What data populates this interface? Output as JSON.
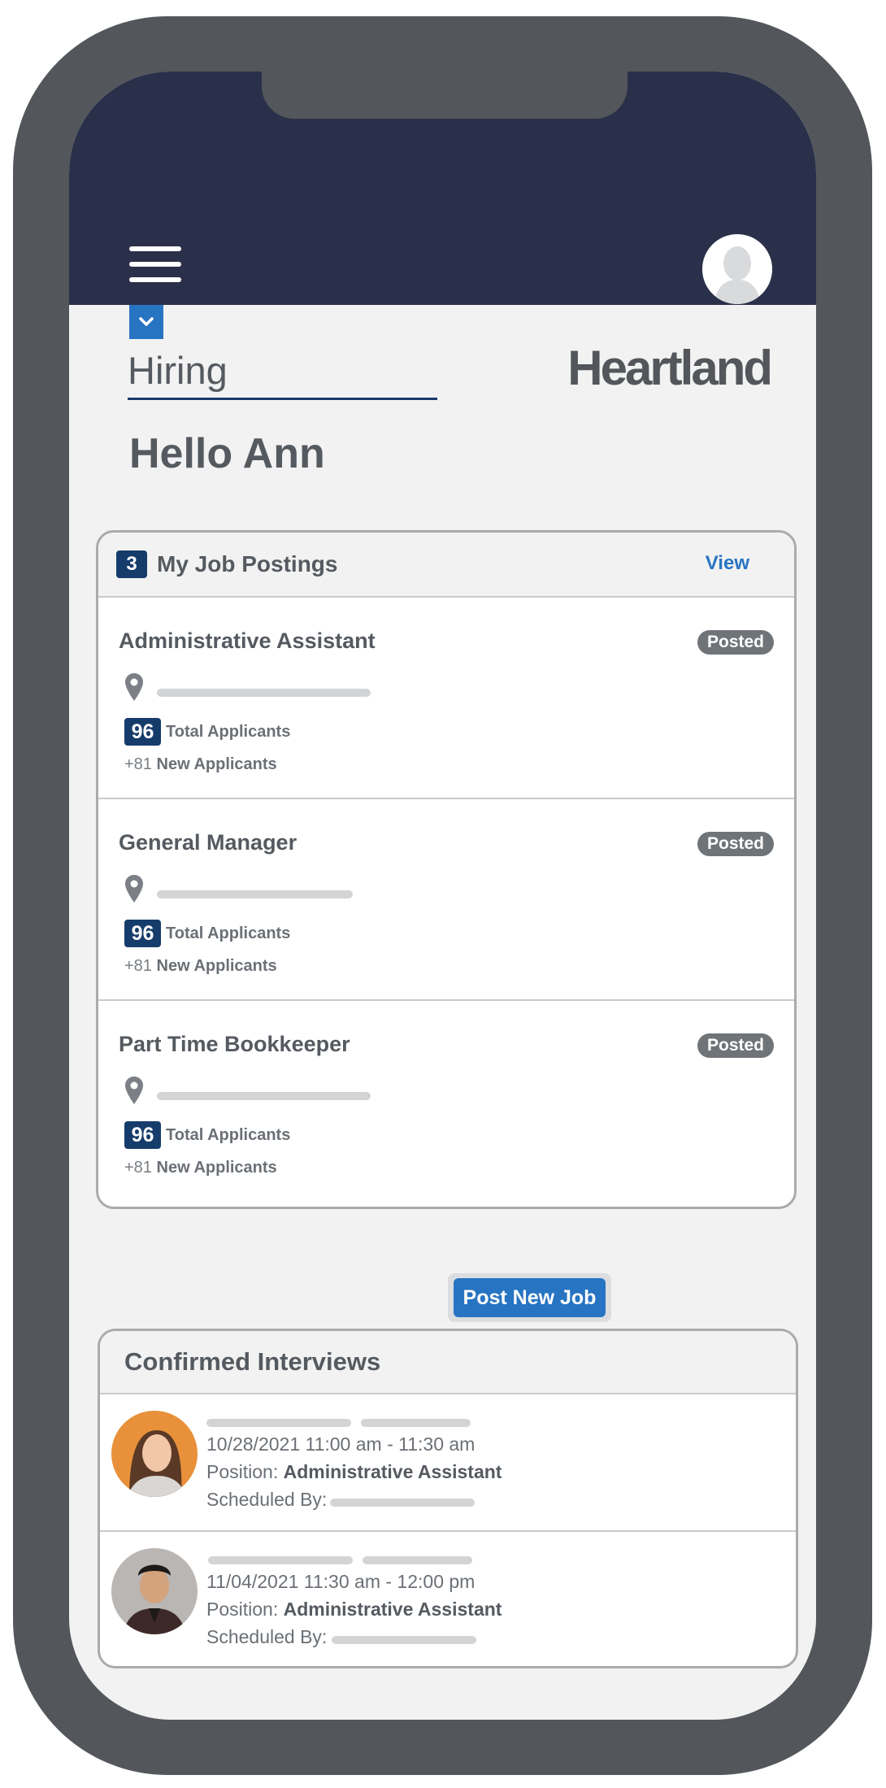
{
  "header": {
    "section_label": "Hiring",
    "brand": "Heartland",
    "greeting": "Hello Ann"
  },
  "job_postings": {
    "count": "3",
    "title": "My Job Postings",
    "view_label": "View",
    "jobs": [
      {
        "title": "Administrative Assistant",
        "status": "Posted",
        "total": "96",
        "total_label": "Total Applicants",
        "new_count": "+81",
        "new_label": "New Applicants"
      },
      {
        "title": "General Manager",
        "status": "Posted",
        "total": "96",
        "total_label": "Total Applicants",
        "new_count": "+81",
        "new_label": "New Applicants"
      },
      {
        "title": "Part Time Bookkeeper",
        "status": "Posted",
        "total": "96",
        "total_label": "Total Applicants",
        "new_count": "+81",
        "new_label": "New Applicants"
      }
    ]
  },
  "post_new_job_label": "Post New Job",
  "interviews": {
    "title": "Confirmed Interviews",
    "items": [
      {
        "datetime": "10/28/2021 11:00 am - 11:30 am",
        "position_label": "Position:",
        "position": "Administrative Assistant",
        "scheduled_label": "Scheduled By:"
      },
      {
        "datetime": "11/04/2021 11:30 am - 12:00 pm",
        "position_label": "Position:",
        "position": "Administrative Assistant",
        "scheduled_label": "Scheduled By:"
      }
    ]
  },
  "colors": {
    "header_bg": "#2a3049",
    "accent_blue": "#2774c2",
    "badge_navy": "#163c6b",
    "frame": "#53565b"
  },
  "icons": [
    "hamburger-menu-icon",
    "user-avatar-icon",
    "chevron-down-icon",
    "location-pin-icon"
  ]
}
